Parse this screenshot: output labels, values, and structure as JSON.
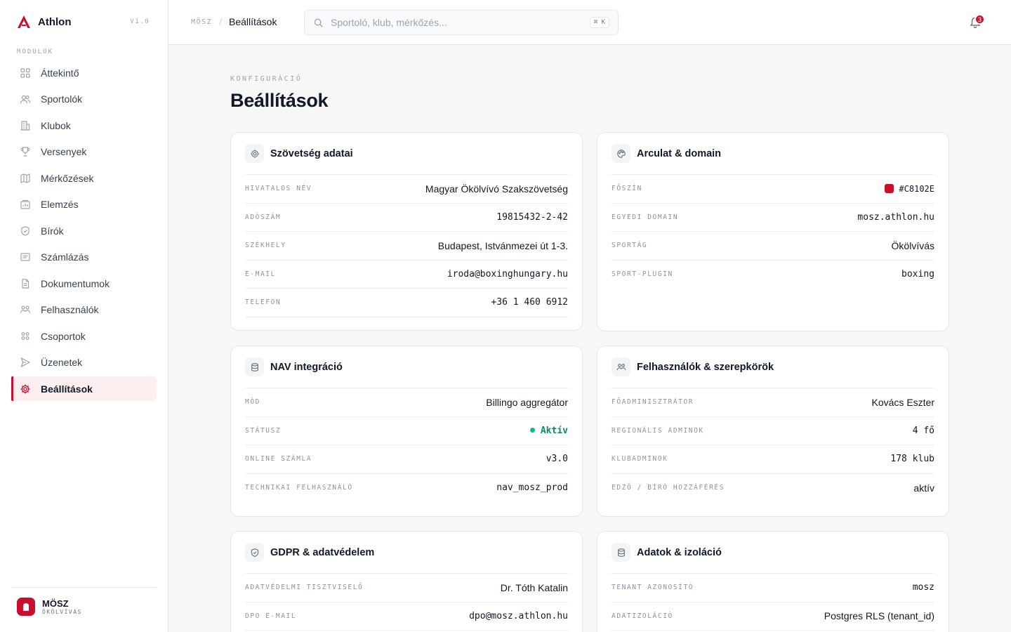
{
  "app": {
    "name": "Athlon",
    "version": "V1.0"
  },
  "sidebar": {
    "section_label": "MODULOK",
    "items": [
      {
        "label": "Áttekintő",
        "icon": "grid-icon",
        "active": false
      },
      {
        "label": "Sportolók",
        "icon": "users-icon",
        "active": false
      },
      {
        "label": "Klubok",
        "icon": "building-icon",
        "active": false
      },
      {
        "label": "Versenyek",
        "icon": "trophy-icon",
        "active": false
      },
      {
        "label": "Mérkőzések",
        "icon": "map-icon",
        "active": false
      },
      {
        "label": "Elemzés",
        "icon": "chart-icon",
        "active": false
      },
      {
        "label": "Bírók",
        "icon": "shield-icon",
        "active": false
      },
      {
        "label": "Számlázás",
        "icon": "receipt-icon",
        "active": false
      },
      {
        "label": "Dokumentumok",
        "icon": "document-icon",
        "active": false
      },
      {
        "label": "Felhasználók",
        "icon": "user-group-icon",
        "active": false
      },
      {
        "label": "Csoportok",
        "icon": "groups-icon",
        "active": false
      },
      {
        "label": "Üzenetek",
        "icon": "send-icon",
        "active": false
      },
      {
        "label": "Beállítások",
        "icon": "gear-icon",
        "active": true
      }
    ],
    "org": {
      "name": "MÖSZ",
      "subtitle": "ÖKÖLVÍVÁS"
    }
  },
  "topbar": {
    "breadcrumb": {
      "root": "MÖSZ",
      "separator": "/",
      "current": "Beállítások"
    },
    "search": {
      "placeholder": "Sportoló, klub, mérkőzés...",
      "value": "",
      "shortcut": "⌘ K"
    },
    "notifications": {
      "count": "3"
    }
  },
  "page": {
    "eyebrow": "KONFIGURÁCIÓ",
    "title": "Beállítások"
  },
  "colors": {
    "accent": "#C8102E",
    "success": "#10B981"
  },
  "cards": {
    "federation": {
      "title": "Szövetség adatai",
      "icon": "gear-icon",
      "rows": [
        {
          "label": "HIVATALOS NÉV",
          "value": "Magyar Ökölvívó Szakszövetség"
        },
        {
          "label": "ADÓSZÁM",
          "value": "19815432-2-42"
        },
        {
          "label": "SZÉKHELY",
          "value": "Budapest, Istvánmezei út 1-3."
        },
        {
          "label": "E-MAIL",
          "value": "iroda@boxinghungary.hu"
        },
        {
          "label": "TELEFON",
          "value": "+36 1 460 6912"
        }
      ]
    },
    "branding": {
      "title": "Arculat & domain",
      "icon": "palette-icon",
      "rows": [
        {
          "label": "FŐSZÍN",
          "value": "#C8102E"
        },
        {
          "label": "EGYEDI DOMAIN",
          "value": "mosz.athlon.hu"
        },
        {
          "label": "SPORTÁG",
          "value": "Ökölvívás"
        },
        {
          "label": "SPORT-PLUGIN",
          "value": "boxing"
        }
      ]
    },
    "nav": {
      "title": "NAV integráció",
      "icon": "database-icon",
      "rows": [
        {
          "label": "MÓD",
          "value": "Billingo aggregátor"
        },
        {
          "label": "STÁTUSZ",
          "value": "Aktív"
        },
        {
          "label": "ONLINE SZÁMLA",
          "value": "v3.0"
        },
        {
          "label": "TECHNIKAI FELHASZNÁLÓ",
          "value": "nav_mosz_prod"
        }
      ]
    },
    "users": {
      "title": "Felhasználók & szerepkörök",
      "icon": "user-group-icon",
      "rows": [
        {
          "label": "FŐADMINISZTRÁTOR",
          "value": "Kovács Eszter"
        },
        {
          "label": "REGIONÁLIS ADMINOK",
          "value": "4 fő"
        },
        {
          "label": "KLUBADMINOK",
          "value": "178 klub"
        },
        {
          "label": "EDZŐ / BÍRÓ HOZZÁFÉRÉS",
          "value": "aktív"
        }
      ]
    },
    "gdpr": {
      "title": "GDPR & adatvédelem",
      "icon": "shield-icon",
      "rows": [
        {
          "label": "ADATVÉDELMI TISZTVISELŐ",
          "value": "Dr. Tóth Katalin"
        },
        {
          "label": "DPO E-MAIL",
          "value": "dpo@mosz.athlon.hu"
        }
      ]
    },
    "data": {
      "title": "Adatok & izoláció",
      "icon": "database-icon",
      "rows": [
        {
          "label": "TENANT AZONOSÍTÓ",
          "value": "mosz"
        },
        {
          "label": "ADATIZOLÁCIÓ",
          "value": "Postgres RLS (tenant_id)"
        }
      ]
    }
  }
}
